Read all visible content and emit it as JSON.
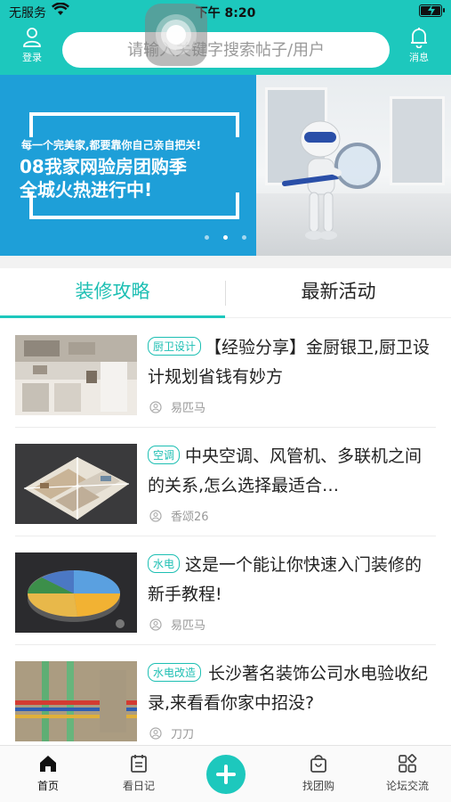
{
  "status_bar": {
    "carrier": "无服务",
    "time": "下午 8:20"
  },
  "header": {
    "login_label": "登录",
    "search_placeholder": "请输入关键字搜索帖子/用户",
    "messages_label": "消息",
    "accent_color": "#1dc8bd"
  },
  "banner": {
    "small_text": "每一个完美家,都要靠你自己亲自把关!",
    "headline_line1": "08我家网验房团购季",
    "headline_line2": "全城火热进行中!",
    "slide_count": 3,
    "active_slide": 1
  },
  "tabs": [
    {
      "label": "装修攻略",
      "active": true
    },
    {
      "label": "最新活动",
      "active": false
    }
  ],
  "articles": [
    {
      "tag": "厨卫设计",
      "title": "【经验分享】金厨银卫,厨卫设计规划省钱有妙方",
      "author": "易匹马",
      "thumb": "kitchen"
    },
    {
      "tag": "空调",
      "title": "中央空调、风管机、多联机之间的关系,怎么选择最适合…",
      "author": "香颂26",
      "thumb": "floorplan"
    },
    {
      "tag": "水电",
      "title": "这是一个能让你快速入门装修的新手教程!",
      "author": "易匹马",
      "thumb": "piechart"
    },
    {
      "tag": "水电改造",
      "title": "长沙著名装饰公司水电验收纪录,来看看你家中招没?",
      "author": "刀刀",
      "thumb": "pipes"
    }
  ],
  "tabbar": {
    "home": "首页",
    "diary": "看日记",
    "group_buy": "找团购",
    "forum": "论坛交流"
  }
}
